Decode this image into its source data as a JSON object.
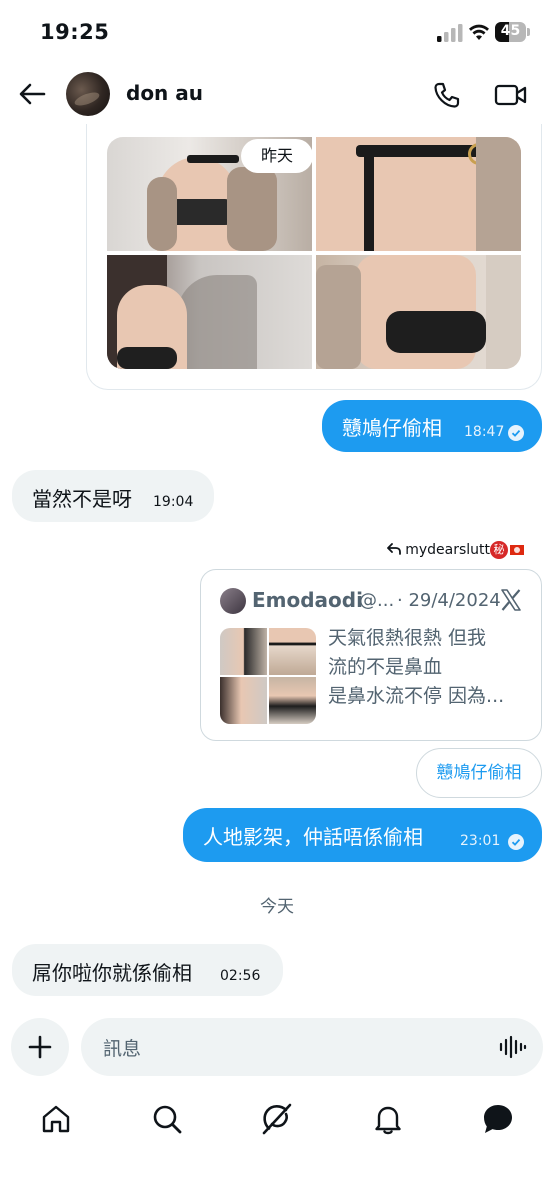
{
  "status_bar": {
    "time": "19:25",
    "battery": "45",
    "battery_level": 0.45
  },
  "header": {
    "name": "don au"
  },
  "messages": [
    {
      "direction": "out",
      "text": "戇鳩仔偷相",
      "time": "18:47"
    },
    {
      "direction": "in",
      "text": "當然不是呀",
      "time": "19:04"
    },
    {
      "direction": "out",
      "text": "人地影架，仲話唔係偷相",
      "time": "23:01"
    },
    {
      "direction": "in",
      "text": "屌你啦你就係偷相",
      "time": "02:56"
    }
  ],
  "media": {
    "date_chip": "昨天"
  },
  "reply_context": {
    "username": "mydearslutt",
    "badge": "秘"
  },
  "tweet_card": {
    "author": "Emodaodi",
    "handle": "@...",
    "date": "· 29/4/2024",
    "lines": [
      "天氣很熱很熱 但我",
      "流的不是鼻血",
      "是鼻水流不停 因為..."
    ]
  },
  "quoted_reply": "戇鳩仔偷相",
  "day_divider": "今天",
  "composer": {
    "placeholder": "訊息"
  },
  "nav": [
    "home-icon",
    "search-icon",
    "grok-icon",
    "notifications-icon",
    "messages-icon"
  ],
  "colors": {
    "accent": "#1d9bf0",
    "bubble_in": "#eff3f4",
    "text": "#0f1419",
    "secondary": "#536471"
  }
}
